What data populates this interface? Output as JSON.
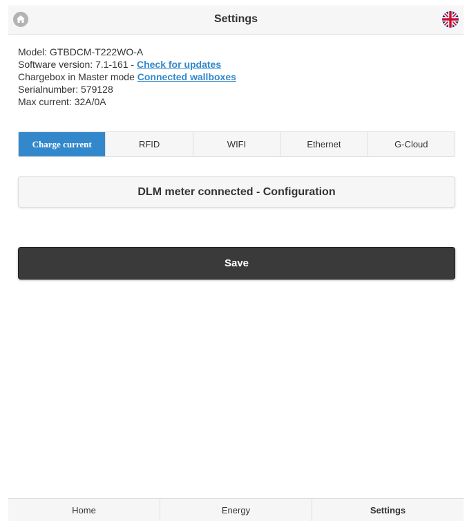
{
  "header": {
    "title": "Settings",
    "home_icon": "home-icon",
    "language_icon": "uk-flag-icon"
  },
  "info": {
    "model": "Model: GTBDCM-T222WO-A",
    "software_prefix": "Software version: 7.1-161 - ",
    "software_link": "Check for updates",
    "mode_prefix": "Chargebox in Master mode ",
    "mode_link": "Connected wallboxes",
    "serial": "Serialnumber: 579128",
    "max_current": "Max current: 32A/0A"
  },
  "tabs": [
    {
      "label": "Charge current",
      "active": true
    },
    {
      "label": "RFID",
      "active": false
    },
    {
      "label": "WIFI",
      "active": false
    },
    {
      "label": "Ethernet",
      "active": false
    },
    {
      "label": "G-Cloud",
      "active": false
    }
  ],
  "dlm": {
    "label": "DLM meter connected - Configuration"
  },
  "save": {
    "label": "Save"
  },
  "footer": {
    "home": "Home",
    "energy": "Energy",
    "settings": "Settings"
  },
  "colors": {
    "accent": "#3388cc",
    "save_button": "#3a3a3a",
    "bar_background": "#f6f6f6"
  }
}
